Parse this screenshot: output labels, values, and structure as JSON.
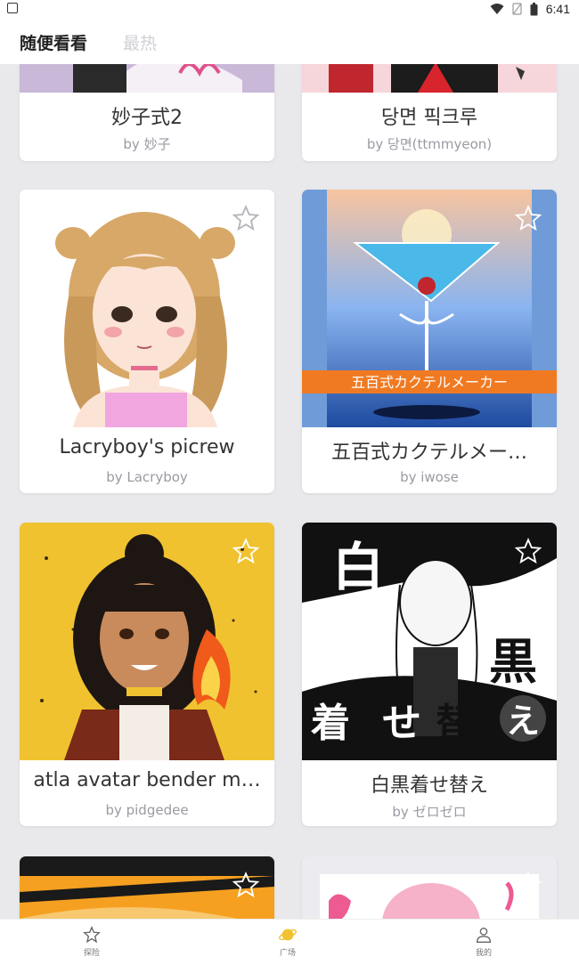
{
  "status": {
    "time": "6:41"
  },
  "header": {
    "tabs": [
      {
        "label": "随便看看"
      },
      {
        "label": "最热"
      }
    ]
  },
  "cards": [
    {
      "title": "妙子式2",
      "author": "by 妙子"
    },
    {
      "title": "당면 픽크루",
      "author": "by 당면(ttmmyeon)"
    },
    {
      "title": "Lacryboy's picrew",
      "author": "by Lacryboy"
    },
    {
      "title": "五百式カクテルメー…",
      "author": "by iwose",
      "banner": "五百式カクテルメーカー"
    },
    {
      "title": "atla avatar bender m…",
      "author": "by pidgedee"
    },
    {
      "title": "白黒着せ替え",
      "author": "by ゼロゼロ",
      "art_text": [
        "白",
        "黒",
        "着",
        "せ",
        "替",
        "え"
      ]
    }
  ],
  "bottom_nav": [
    {
      "label": "探险",
      "icon": "explore-icon"
    },
    {
      "label": "广场",
      "icon": "planet-icon"
    },
    {
      "label": "我的",
      "icon": "profile-icon"
    }
  ],
  "colors": {
    "accent": "#f0c230",
    "background": "#e9e9ec"
  }
}
